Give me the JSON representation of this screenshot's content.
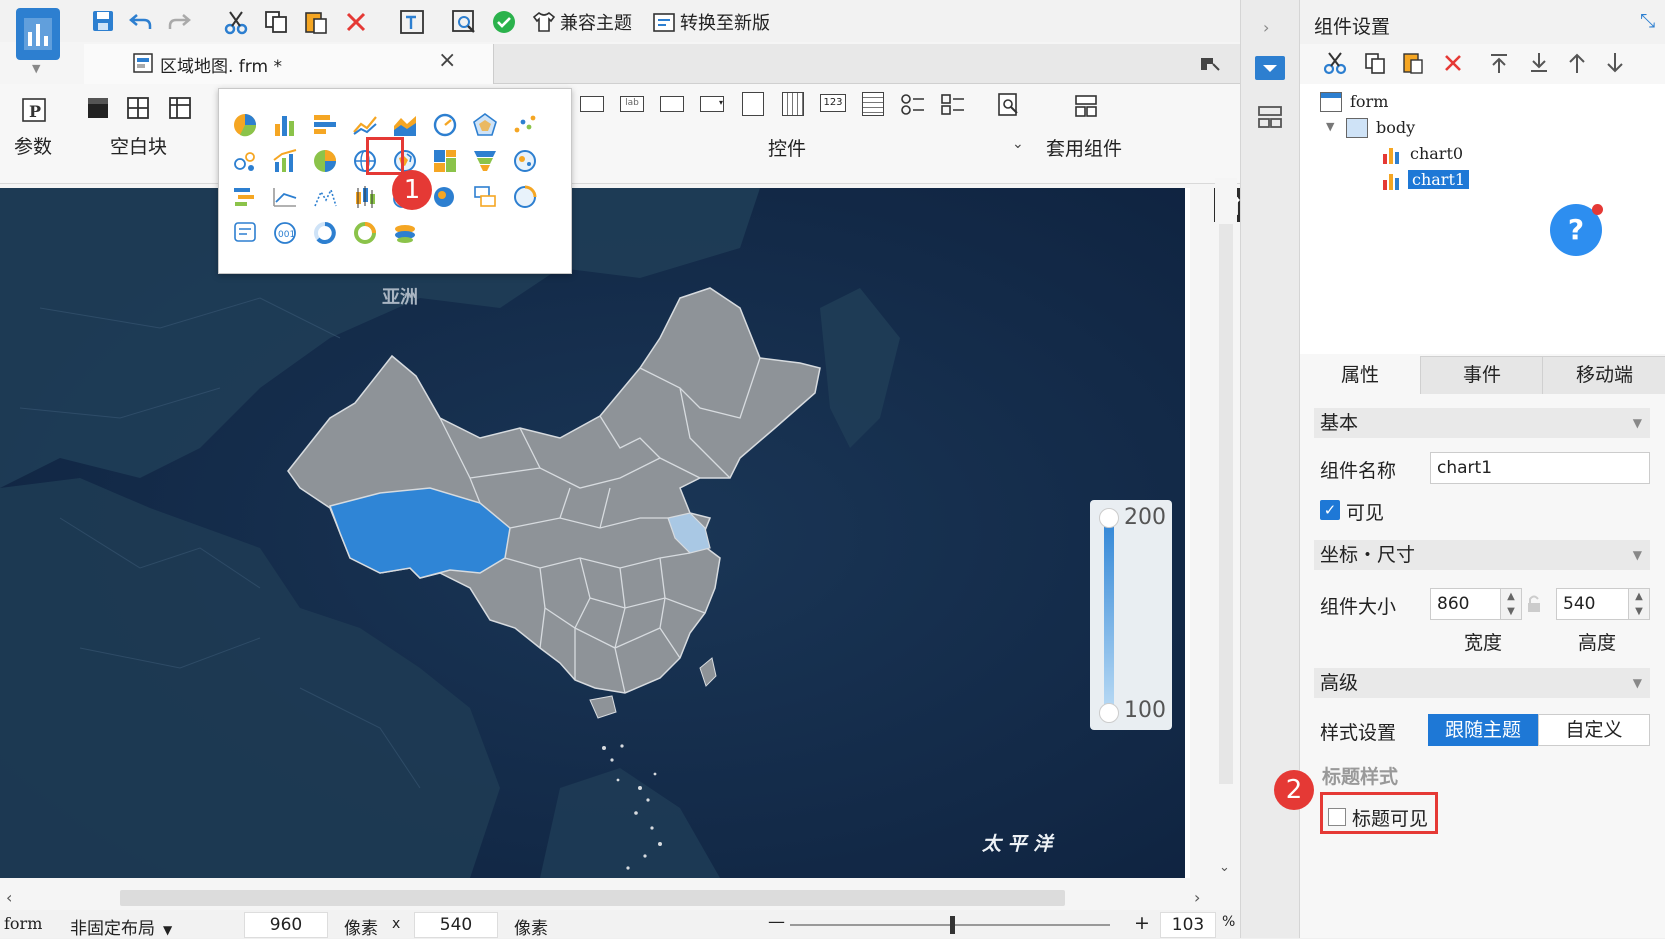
{
  "toolbar": {
    "theme_btn": "兼容主题",
    "convert_btn": "转换至新版"
  },
  "tab": {
    "file_name": "区域地图. frm *",
    "close": "×"
  },
  "ribbon": {
    "param_label": "参数",
    "blank_label": "空白块",
    "control_label": "控件",
    "template_label": "套用组件"
  },
  "map": {
    "asia_label": "亚洲",
    "pacific_label": "太 平 洋",
    "legend_max": "200",
    "legend_min": "100",
    "highlight_color": "#2f85d6",
    "province_color": "#8e9398",
    "sea_color": "#13294a"
  },
  "status": {
    "layer": "form",
    "layout": "非固定布局",
    "width": "960",
    "unit1": "像素",
    "x": "x",
    "height": "540",
    "unit2": "像素",
    "minus": "—",
    "plus": "+",
    "zoom": "103",
    "pct": "%"
  },
  "panel": {
    "title": "组件设置",
    "tree": {
      "root": "form",
      "body": "body",
      "chart0": "chart0",
      "chart1": "chart1"
    },
    "tabs": [
      "属性",
      "事件",
      "移动端"
    ],
    "basic": "基本",
    "name_label": "组件名称",
    "name_value": "chart1",
    "visible_label": "可见",
    "coord_section": "坐标・尺寸",
    "size_label": "组件大小",
    "width_value": "860",
    "height_value": "540",
    "width_caption": "宽度",
    "height_caption": "高度",
    "advanced": "高级",
    "style_label": "样式设置",
    "style_follow": "跟随主题",
    "style_custom": "自定义",
    "title_style": "标题样式",
    "title_visible": "标题可见"
  },
  "annotations": {
    "badge1": "1",
    "badge2": "2"
  },
  "help": "?"
}
